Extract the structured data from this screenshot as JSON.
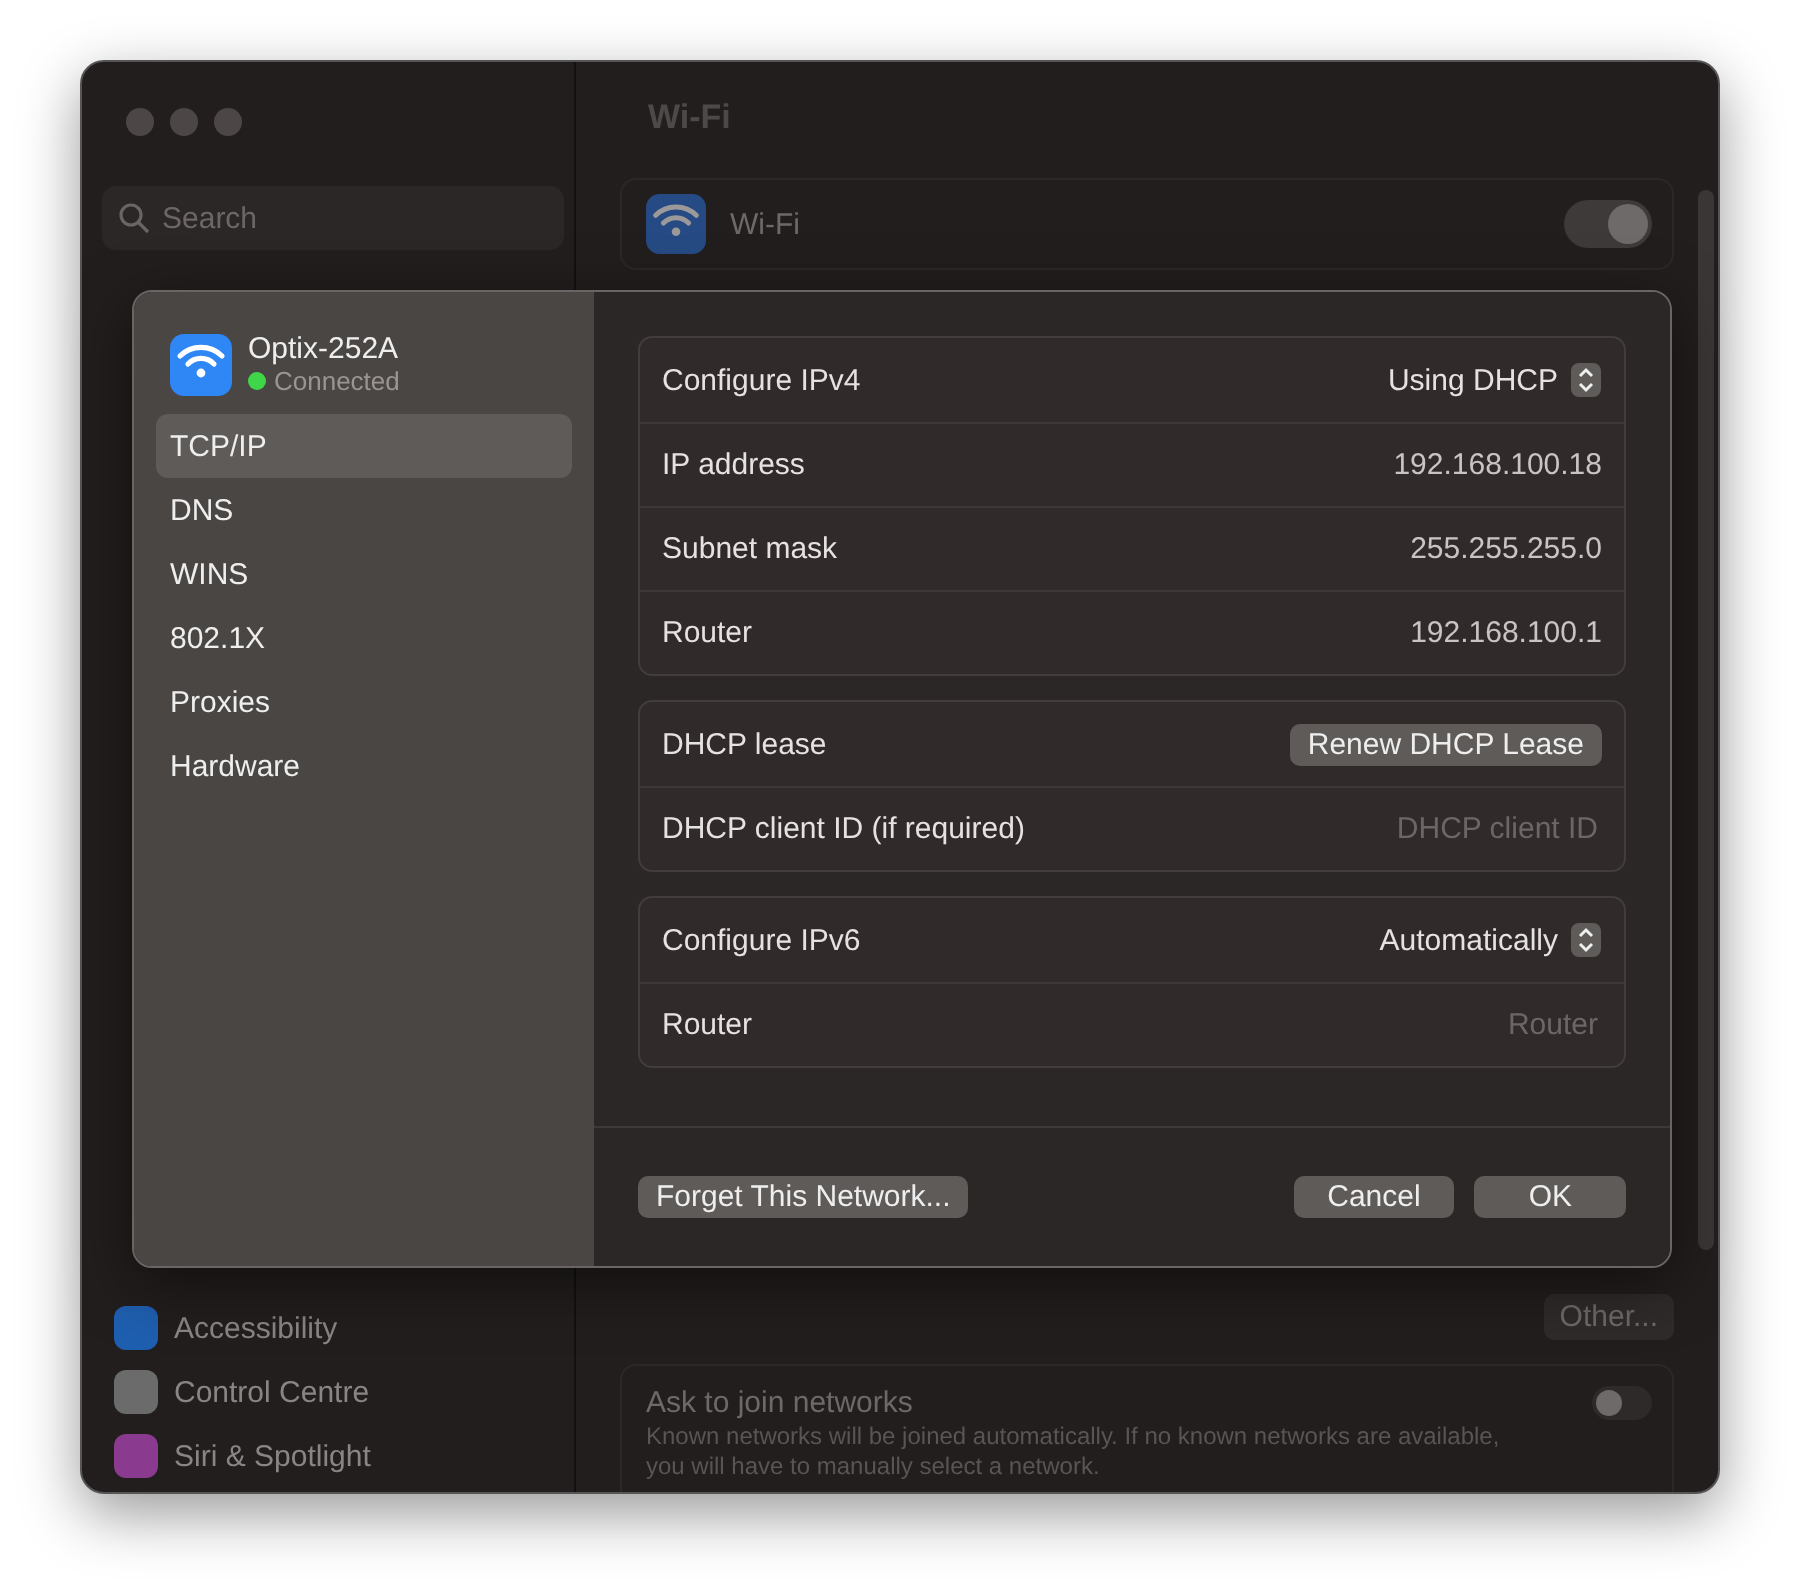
{
  "sidebar": {
    "search": {
      "placeholder": "Search"
    },
    "items": [
      {
        "label": "Accessibility",
        "color": "#1f5fb0"
      },
      {
        "label": "Control Centre",
        "color": "#6b6b6b"
      },
      {
        "label": "Siri & Spotlight",
        "color": "#8a3a8f"
      }
    ]
  },
  "main": {
    "title": "Wi-Fi",
    "wifi": {
      "label": "Wi-Fi",
      "on": true
    },
    "other_button": "Other...",
    "ask_to_join": {
      "label": "Ask to join networks",
      "description": "Known networks will be joined automatically. If no known networks are available, you will have to manually select a network.",
      "on": false
    }
  },
  "sheet": {
    "network": {
      "name": "Optix-252A",
      "status": "Connected",
      "connected": true
    },
    "tabs": [
      {
        "label": "TCP/IP",
        "selected": true
      },
      {
        "label": "DNS",
        "selected": false
      },
      {
        "label": "WINS",
        "selected": false
      },
      {
        "label": "802.1X",
        "selected": false
      },
      {
        "label": "Proxies",
        "selected": false
      },
      {
        "label": "Hardware",
        "selected": false
      }
    ],
    "groups": [
      {
        "rows": [
          {
            "label": "Configure IPv4",
            "kind": "popup",
            "value": "Using DHCP"
          },
          {
            "label": "IP address",
            "kind": "value",
            "value": "192.168.100.18"
          },
          {
            "label": "Subnet mask",
            "kind": "value",
            "value": "255.255.255.0"
          },
          {
            "label": "Router",
            "kind": "value",
            "value": "192.168.100.1"
          }
        ]
      },
      {
        "rows": [
          {
            "label": "DHCP lease",
            "kind": "button",
            "value": "Renew DHCP Lease"
          },
          {
            "label": "DHCP client ID (if required)",
            "kind": "field",
            "placeholder": "DHCP client ID"
          }
        ]
      },
      {
        "rows": [
          {
            "label": "Configure IPv6",
            "kind": "popup",
            "value": "Automatically"
          },
          {
            "label": "Router",
            "kind": "field",
            "placeholder": "Router"
          }
        ]
      }
    ],
    "forget_button": "Forget This Network...",
    "cancel_button": "Cancel",
    "ok_button": "OK"
  }
}
